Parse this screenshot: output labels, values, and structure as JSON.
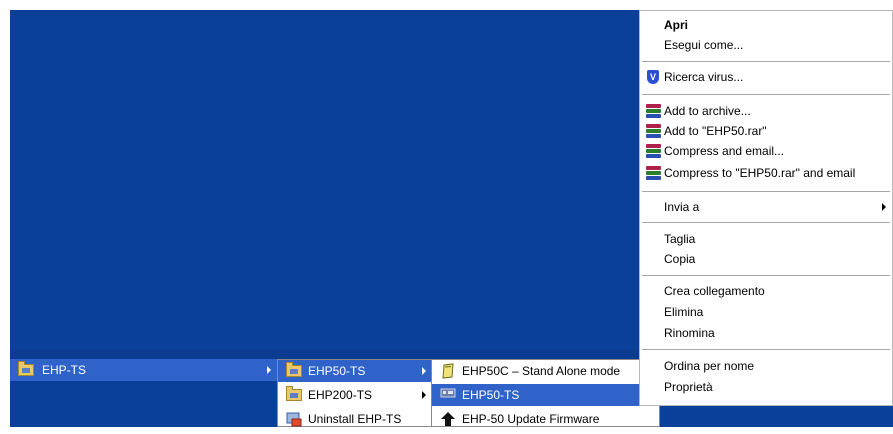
{
  "context_menu": {
    "items": [
      {
        "label": "Apri",
        "bold": true
      },
      {
        "label": "Esegui come..."
      },
      {
        "label": "Ricerca virus..."
      },
      {
        "label": "Add to archive..."
      },
      {
        "label": "Add to \"EHP50.rar\""
      },
      {
        "label": "Compress and email..."
      },
      {
        "label": "Compress to \"EHP50.rar\" and email"
      },
      {
        "label": "Invia a"
      },
      {
        "label": "Taglia"
      },
      {
        "label": "Copia"
      },
      {
        "label": "Crea collegamento"
      },
      {
        "label": "Elimina"
      },
      {
        "label": "Rinomina"
      },
      {
        "label": "Ordina per nome"
      },
      {
        "label": "Proprietà"
      }
    ]
  },
  "start_menu": {
    "level1": [
      {
        "label": "EHP-TS"
      }
    ],
    "level2": [
      {
        "label": "EHP50-TS"
      },
      {
        "label": "EHP200-TS"
      },
      {
        "label": "Uninstall EHP-TS"
      }
    ],
    "level3": [
      {
        "label": "EHP50C – Stand Alone mode"
      },
      {
        "label": "EHP50-TS"
      },
      {
        "label": "EHP-50 Update Firmware"
      }
    ]
  },
  "colors": {
    "desktop": "#0a3f9a",
    "highlight": "#2f63c9"
  }
}
